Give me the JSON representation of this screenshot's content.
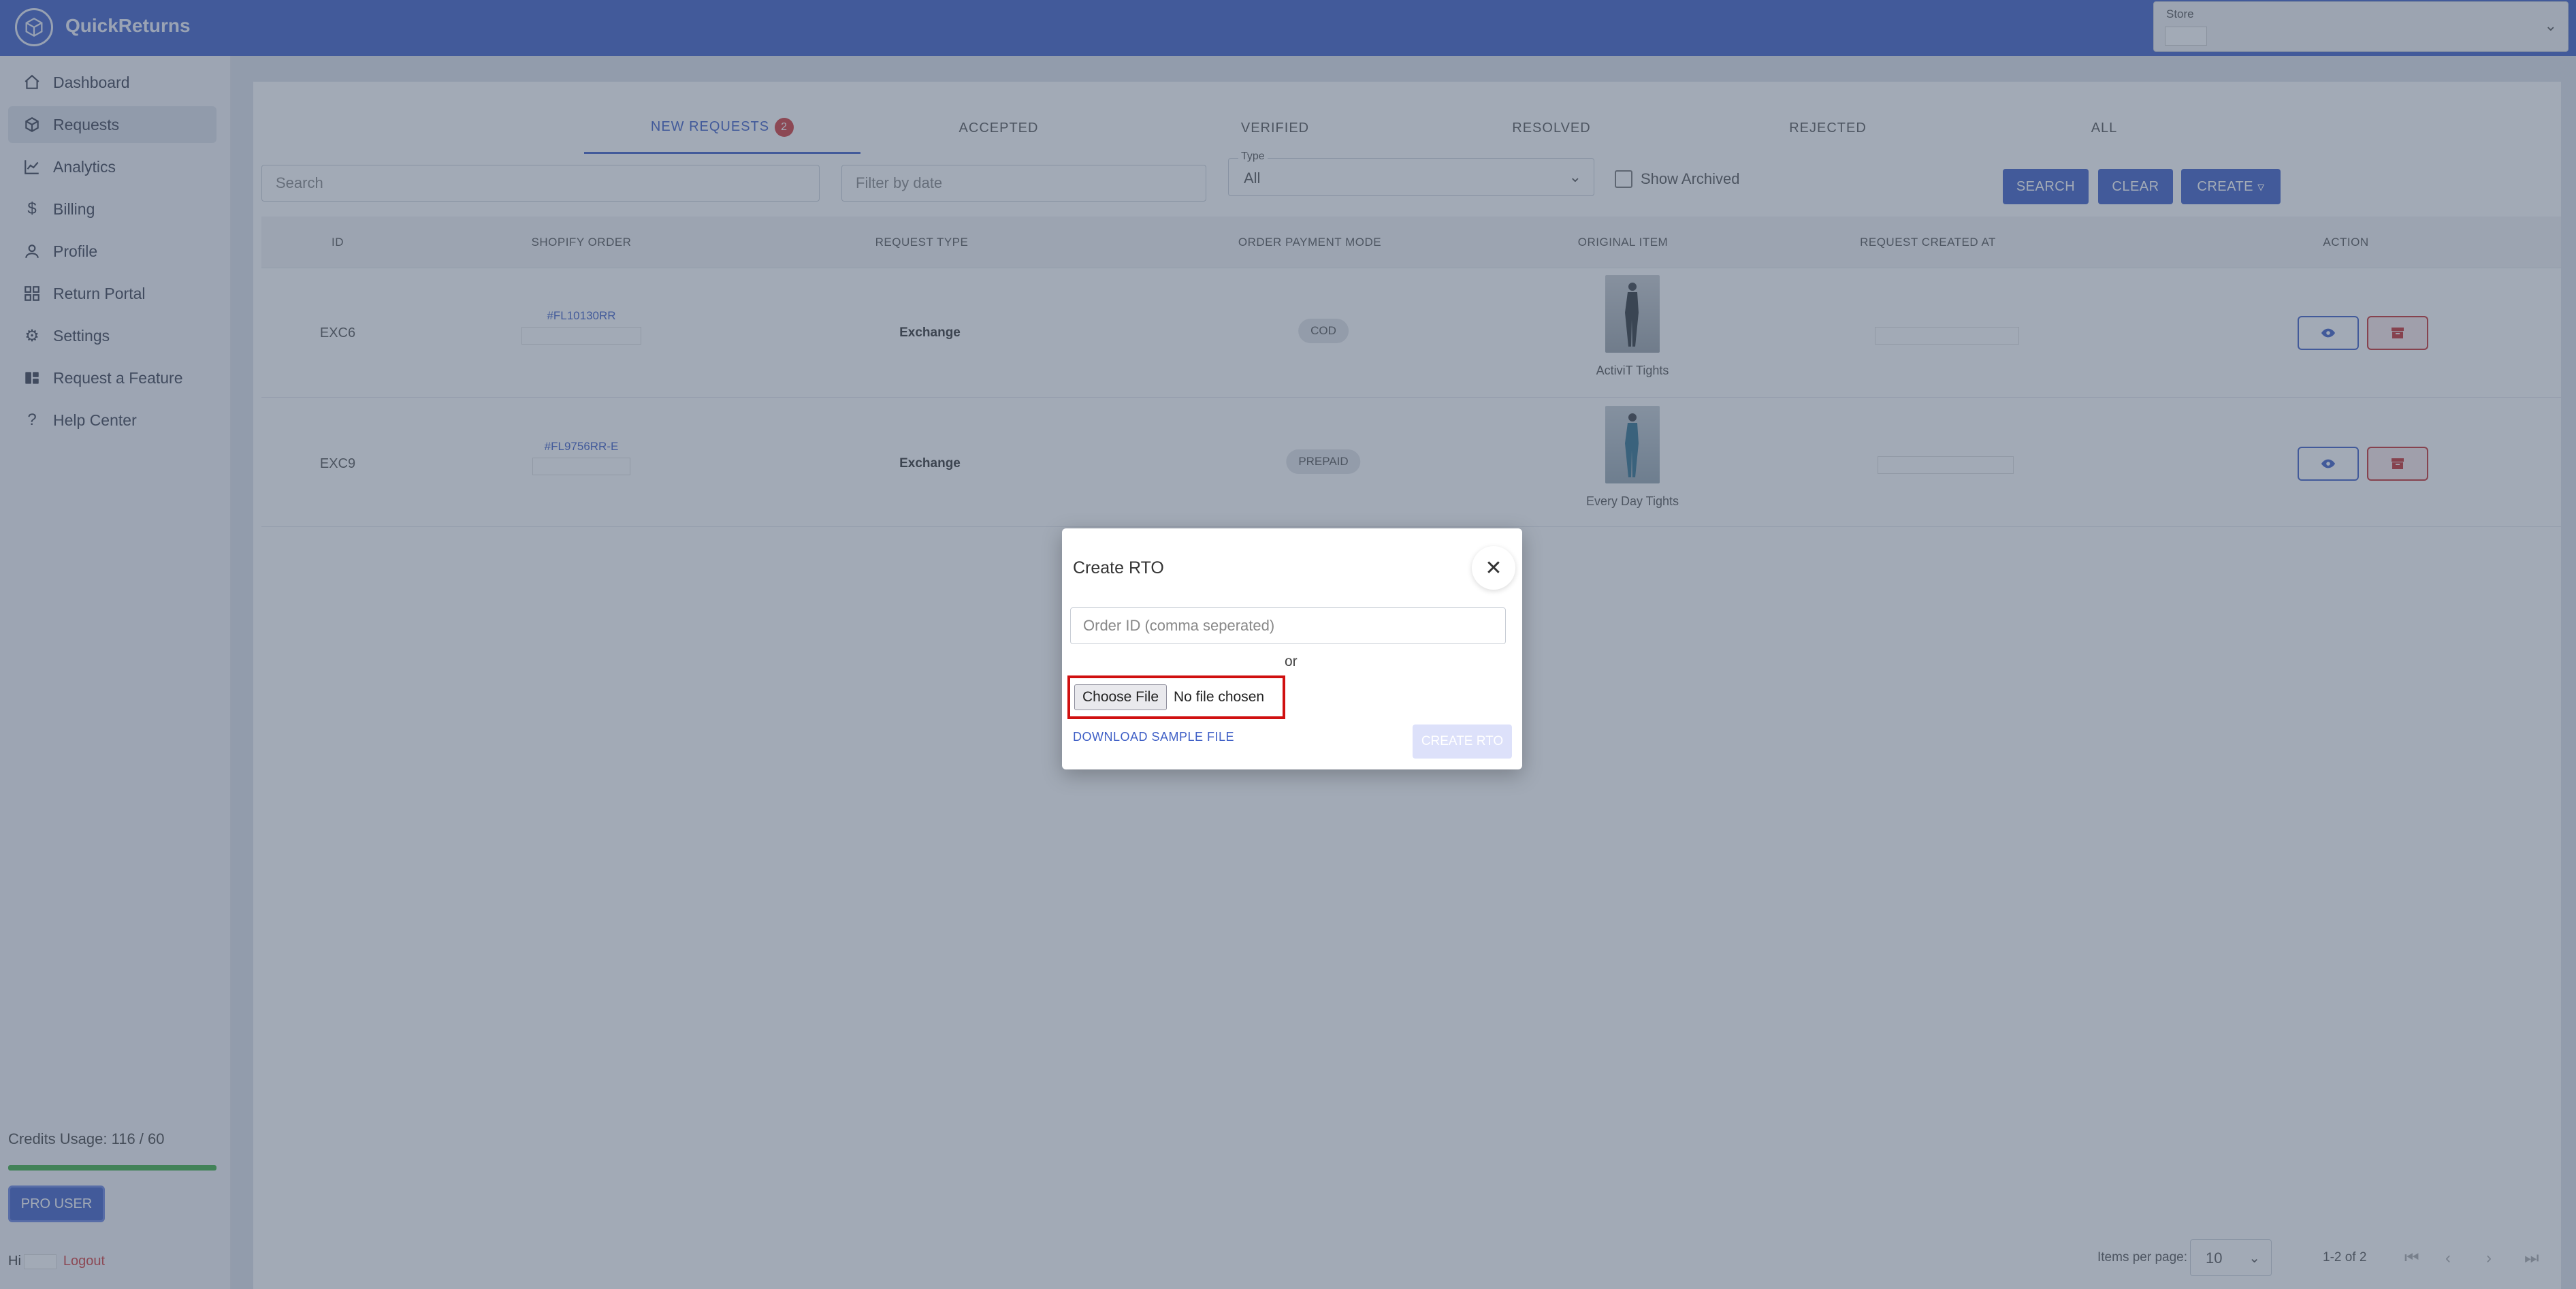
{
  "app": {
    "name": "QuickReturns"
  },
  "store": {
    "label": "Store"
  },
  "sidebar": {
    "items": [
      {
        "label": "Dashboard",
        "icon": "home-icon"
      },
      {
        "label": "Requests",
        "icon": "box-icon"
      },
      {
        "label": "Analytics",
        "icon": "chart-line-icon"
      },
      {
        "label": "Billing",
        "icon": "dollar-icon"
      },
      {
        "label": "Profile",
        "icon": "user-icon"
      },
      {
        "label": "Return Portal",
        "icon": "grid-icon"
      },
      {
        "label": "Settings",
        "icon": "gear-icon"
      },
      {
        "label": "Request a Feature",
        "icon": "feature-icon"
      },
      {
        "label": "Help Center",
        "icon": "question-icon"
      }
    ],
    "credits": "Credits Usage: 116 / 60",
    "pro_label": "PRO USER",
    "greeting": "Hi",
    "logout": "Logout"
  },
  "tabs": [
    {
      "label": "NEW REQUESTS",
      "badge": "2"
    },
    {
      "label": "ACCEPTED"
    },
    {
      "label": "VERIFIED"
    },
    {
      "label": "RESOLVED"
    },
    {
      "label": "REJECTED"
    },
    {
      "label": "ALL"
    }
  ],
  "filters": {
    "search_placeholder": "Search",
    "date_placeholder": "Filter by date",
    "type_label": "Type",
    "type_value": "All",
    "show_archived": "Show Archived",
    "search_btn": "SEARCH",
    "clear_btn": "CLEAR",
    "create_btn": "CREATE"
  },
  "table": {
    "headers": [
      "ID",
      "SHOPIFY ORDER",
      "REQUEST TYPE",
      "ORDER PAYMENT MODE",
      "ORIGINAL ITEM",
      "REQUEST CREATED AT",
      "ACTION"
    ],
    "rows": [
      {
        "id": "EXC6",
        "order": "#FL10130RR",
        "type": "Exchange",
        "payment": "COD",
        "item": "ActiviT Tights"
      },
      {
        "id": "EXC9",
        "order": "#FL9756RR-E",
        "type": "Exchange",
        "payment": "PREPAID",
        "item": "Every Day Tights"
      }
    ]
  },
  "pagination": {
    "items_per_page_label": "Items per page:",
    "items_per_page": "10",
    "range": "1-2 of 2"
  },
  "modal": {
    "title": "Create RTO",
    "order_placeholder": "Order ID (comma seperated)",
    "or": "or",
    "choose_file": "Choose File",
    "file_status": "No file chosen",
    "download_link": "DOWNLOAD SAMPLE FILE",
    "submit": "CREATE RTO"
  },
  "colors": {
    "primary": "#3f5fc6",
    "danger": "#d23b3b",
    "highlight": "#d01010"
  }
}
